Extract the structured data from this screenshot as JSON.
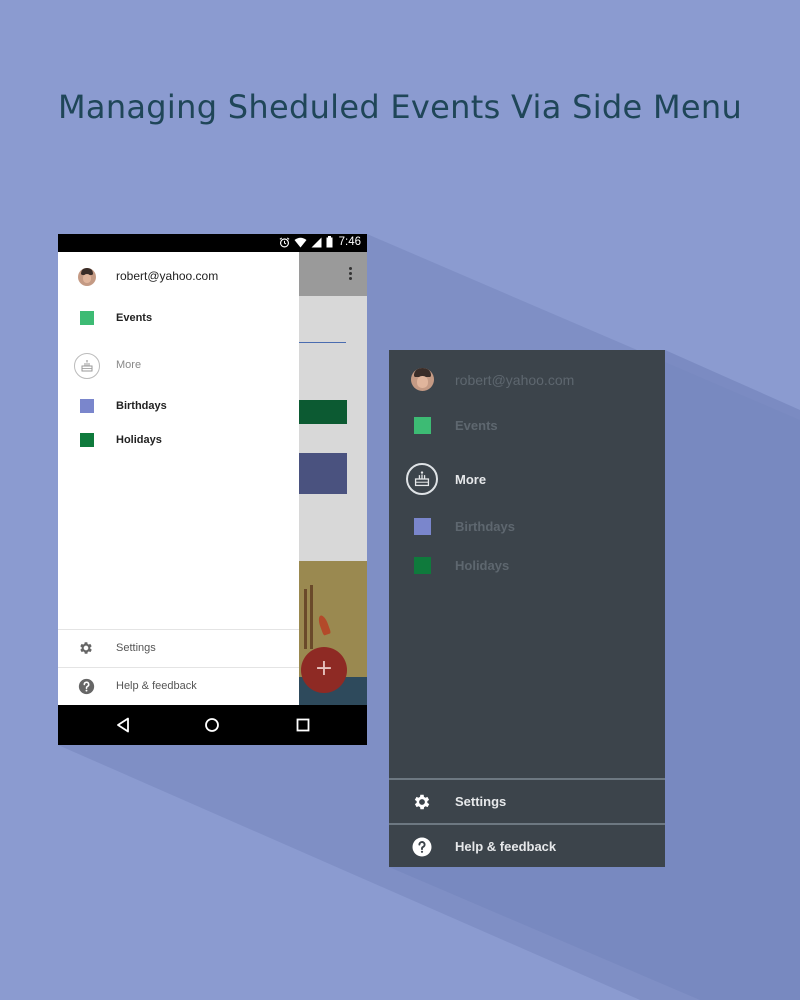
{
  "page": {
    "title": "Managing Sheduled Events Via Side Menu",
    "background_color": "#8b9bd0",
    "title_color": "#1f4658"
  },
  "phone": {
    "status_bar": {
      "time": "7:46",
      "icons": [
        "alarm-icon",
        "wifi-icon",
        "signal-icon",
        "battery-icon"
      ]
    },
    "app_behind": {
      "toolbar_icon": "overflow-menu-icon",
      "fab_label": "+",
      "fab_color": "#8e2a24"
    },
    "drawer": {
      "account_email": "robert@yahoo.com",
      "calendars": [
        {
          "label": "Events",
          "color": "#3dbb74"
        }
      ],
      "more": {
        "label": "More",
        "icon": "cake-icon"
      },
      "more_calendars": [
        {
          "label": "Birthdays",
          "color": "#7a86cc"
        },
        {
          "label": "Holidays",
          "color": "#0f7a3c"
        }
      ],
      "footer": [
        {
          "label": "Settings",
          "icon": "gear-icon"
        },
        {
          "label": "Help & feedback",
          "icon": "help-icon"
        }
      ]
    },
    "nav_bar": {
      "buttons": [
        "back-icon",
        "home-icon",
        "recents-icon"
      ]
    }
  },
  "dark_menu": {
    "background_color": "#3c444b",
    "account_email": "robert@yahoo.com",
    "calendars": [
      {
        "label": "Events",
        "color": "#3dbb74"
      }
    ],
    "more": {
      "label": "More",
      "icon": "cake-icon"
    },
    "more_calendars": [
      {
        "label": "Birthdays",
        "color": "#7a86cc"
      },
      {
        "label": "Holidays",
        "color": "#0f7a3c"
      }
    ],
    "footer": [
      {
        "label": "Settings",
        "icon": "gear-icon"
      },
      {
        "label": "Help & feedback",
        "icon": "help-icon"
      }
    ]
  }
}
